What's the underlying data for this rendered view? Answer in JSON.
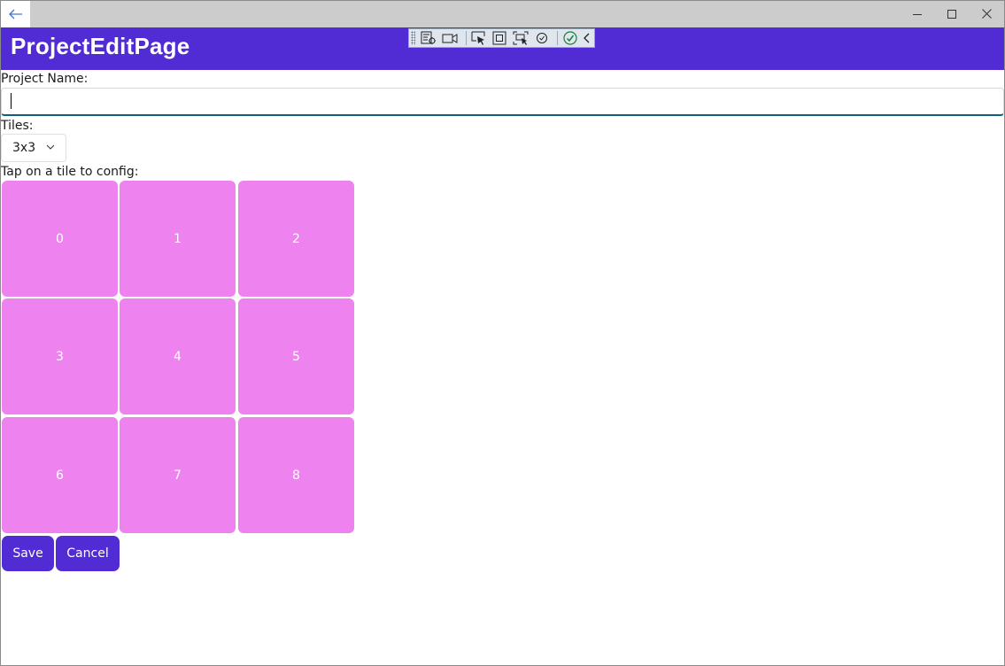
{
  "window": {
    "back_icon": "arrow-left-icon",
    "minimize_icon": "minimize-icon",
    "maximize_icon": "maximize-icon",
    "close_icon": "close-icon"
  },
  "header": {
    "title": "ProjectEditPage",
    "color": "#512bd4"
  },
  "debug_toolbar": {
    "icons": [
      "live-visual-tree-icon",
      "record-icon",
      "select-element-icon",
      "display-layout-adorners-icon",
      "track-focus-icon",
      "hot-reload-icon",
      "binding-check-icon",
      "collapse-icon"
    ]
  },
  "form": {
    "project_name_label": "Project Name:",
    "project_name_value": "",
    "tiles_label": "Tiles:",
    "tiles_selected": "3x3",
    "tap_label": "Tap on a tile to config:",
    "tile_color": "#ee82ee",
    "tiles": [
      "0",
      "1",
      "2",
      "3",
      "4",
      "5",
      "6",
      "7",
      "8"
    ]
  },
  "actions": {
    "save_label": "Save",
    "cancel_label": "Cancel"
  }
}
